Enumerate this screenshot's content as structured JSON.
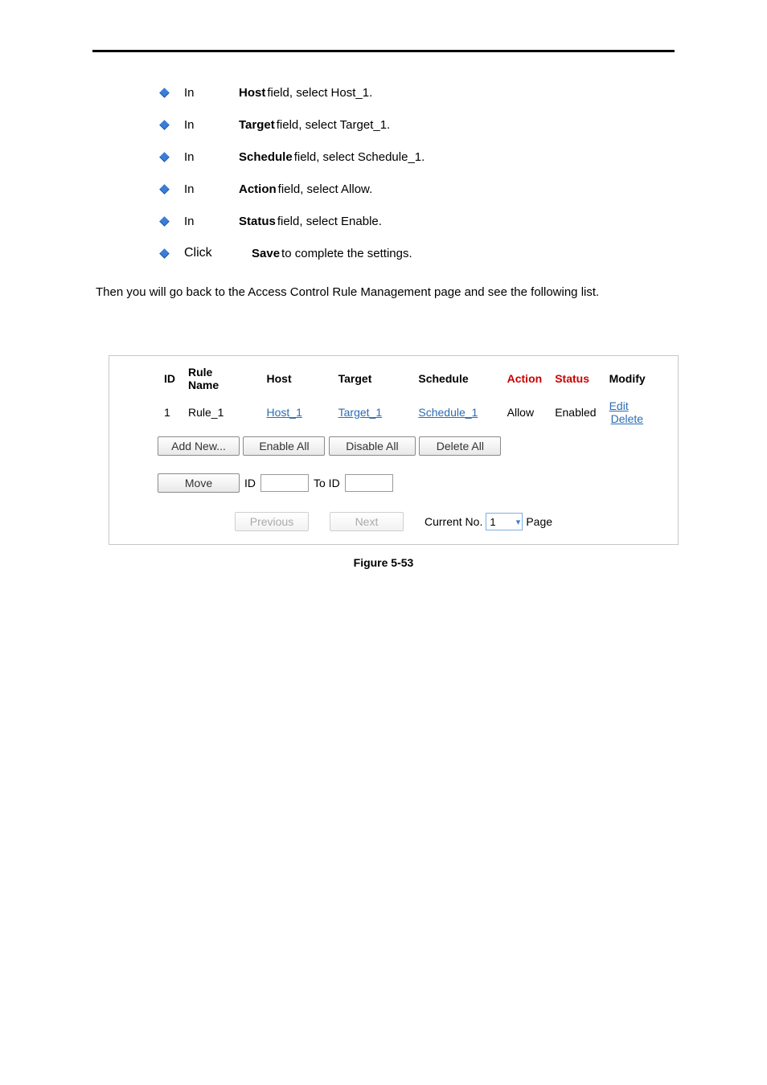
{
  "bullets": [
    {
      "before": "In ",
      "label": "Host",
      "after": " field, select Host_1."
    },
    {
      "before": "In ",
      "label": "Target",
      "after": " field, select Target_1."
    },
    {
      "before": "In ",
      "label": "Schedule",
      "after": " field, select Schedule_1."
    },
    {
      "before": "In ",
      "label": "Action",
      "after": " field, select Allow."
    },
    {
      "before": "In ",
      "label": "Status",
      "after": " field, select Enable."
    },
    {
      "before": "Click ",
      "label": "Save",
      "after": " to complete the settings."
    }
  ],
  "intro": "Then you will go back to the Access Control Rule Management page and see the following list.",
  "table": {
    "headers": {
      "id": "ID",
      "rule": "Rule Name",
      "host": "Host",
      "target": "Target",
      "schedule": "Schedule",
      "action": "Action",
      "status": "Status",
      "modify": "Modify"
    },
    "row": {
      "id": "1",
      "rule": "Rule_1",
      "host": "Host_1",
      "target": "Target_1",
      "schedule": "Schedule_1",
      "action": "Allow",
      "status": "Enabled",
      "edit": "Edit",
      "delete": "Delete"
    }
  },
  "buttons": {
    "add": "Add New...",
    "enable": "Enable All",
    "disable": "Disable All",
    "delete": "Delete All",
    "move": "Move",
    "prev": "Previous",
    "next": "Next"
  },
  "labels": {
    "id": "ID",
    "toid": "To ID",
    "current": "Current No.",
    "page": "Page",
    "selectValue": "1"
  },
  "caption": "Figure 5-53"
}
